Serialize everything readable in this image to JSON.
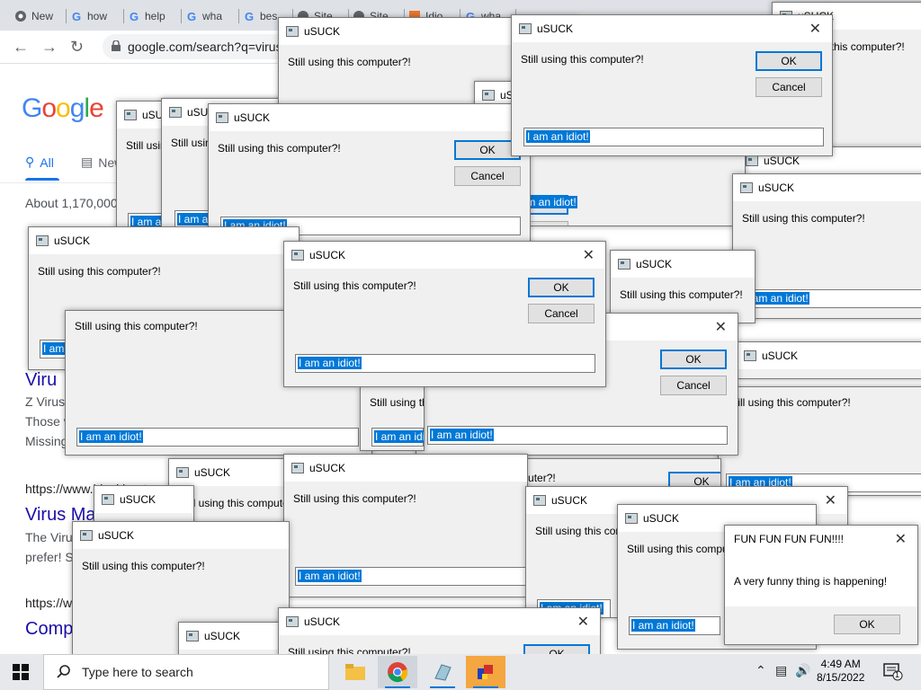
{
  "browser": {
    "tabs": [
      {
        "icon": "chrome-icon",
        "label": "New"
      },
      {
        "icon": "google-icon",
        "label": "how"
      },
      {
        "icon": "google-icon",
        "label": "help"
      },
      {
        "icon": "google-icon",
        "label": "wha"
      },
      {
        "icon": "google-icon",
        "label": "bes"
      },
      {
        "icon": "globe-icon",
        "label": "Site"
      },
      {
        "icon": "globe-icon",
        "label": "Site"
      },
      {
        "icon": "warning-icon",
        "label": "Idio"
      },
      {
        "icon": "google-icon",
        "label": "wha"
      }
    ],
    "url": "google.com/search?q=virus"
  },
  "google": {
    "logo": "Google",
    "nav_all": "All",
    "nav_news": "New",
    "result_count": "About 1,170,000",
    "snippets": [
      "Z Virus",
      "Those v",
      "Missing",
      "https://www.blackbeatz.w",
      "The Virus",
      "prefer! S",
      "https://w"
    ],
    "links": [
      "Virus Ma",
      "Comp",
      "Viru"
    ]
  },
  "dialog": {
    "title": "uSUCK",
    "message": "Still using this computer?!",
    "ok": "OK",
    "cancel": "Cancel",
    "input_value": "I am an idiot!"
  },
  "fun_dialog": {
    "title": "FUN FUN FUN FUN!!!!",
    "message": "A very funny thing is happening!",
    "ok": "OK"
  },
  "taskbar": {
    "search_placeholder": "Type here to search",
    "time": "4:49 AM",
    "date": "8/15/2022",
    "notification_count": "1"
  }
}
